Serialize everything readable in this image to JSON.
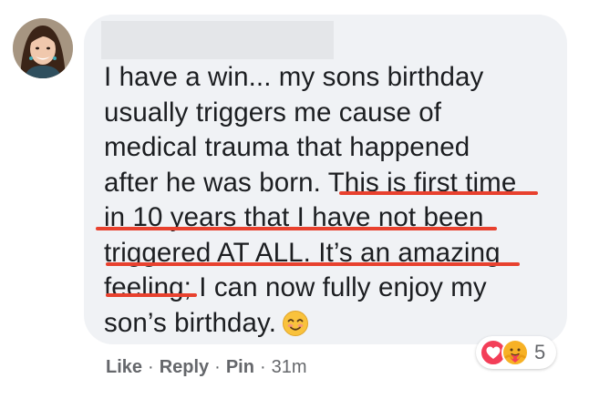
{
  "comment": {
    "author_name_redacted": true,
    "lines": [
      "I have a win... my sons birthday",
      "usually triggers me cause of",
      "medical trauma that happened",
      "after he was born. This is first time",
      "in 10 years that I have not been",
      "triggered AT ALL. It’s an amazing",
      "feeling; I can now fully enjoy my",
      "son’s birthday."
    ],
    "emoji": "smiling-face-icon"
  },
  "actions": {
    "like": "Like",
    "separator": "·",
    "reply": "Reply",
    "pin": "Pin",
    "time": "31m"
  },
  "reactions": {
    "icons": [
      "heart-reaction-icon",
      "care-reaction-icon"
    ],
    "count": "5"
  },
  "colors": {
    "bubble": "#f0f2f5",
    "text": "#1c1e21",
    "meta": "#65676b",
    "underline": "#e8412e",
    "heart": "#f33e58",
    "care": "#f7b125"
  }
}
